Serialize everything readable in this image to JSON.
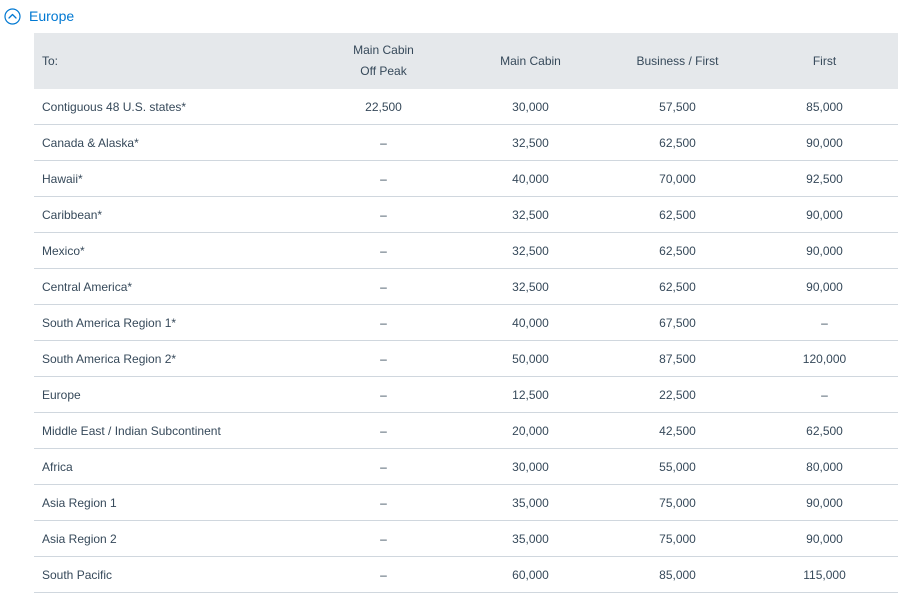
{
  "section": {
    "title": "Europe",
    "toggle_icon": "chevron-up-circle-icon",
    "accent_color": "#0078d2"
  },
  "table": {
    "headers": {
      "to": "To:",
      "main_off_peak_line1": "Main Cabin",
      "main_off_peak_line2": "Off Peak",
      "main_cabin": "Main Cabin",
      "business_first": "Business / First",
      "first": "First"
    },
    "rows": [
      {
        "region": "Contiguous 48 U.S. states*",
        "off_peak": "22,500",
        "main": "30,000",
        "business": "57,500",
        "first": "85,000"
      },
      {
        "region": "Canada & Alaska*",
        "off_peak": "–",
        "main": "32,500",
        "business": "62,500",
        "first": "90,000"
      },
      {
        "region": "Hawaii*",
        "off_peak": "–",
        "main": "40,000",
        "business": "70,000",
        "first": "92,500"
      },
      {
        "region": "Caribbean*",
        "off_peak": "–",
        "main": "32,500",
        "business": "62,500",
        "first": "90,000"
      },
      {
        "region": "Mexico*",
        "off_peak": "–",
        "main": "32,500",
        "business": "62,500",
        "first": "90,000"
      },
      {
        "region": "Central America*",
        "off_peak": "–",
        "main": "32,500",
        "business": "62,500",
        "first": "90,000"
      },
      {
        "region": "South America Region 1*",
        "off_peak": "–",
        "main": "40,000",
        "business": "67,500",
        "first": "–"
      },
      {
        "region": "South America Region 2*",
        "off_peak": "–",
        "main": "50,000",
        "business": "87,500",
        "first": "120,000"
      },
      {
        "region": "Europe",
        "off_peak": "–",
        "main": "12,500",
        "business": "22,500",
        "first": "–"
      },
      {
        "region": "Middle East / Indian Subcontinent",
        "off_peak": "–",
        "main": "20,000",
        "business": "42,500",
        "first": "62,500"
      },
      {
        "region": "Africa",
        "off_peak": "–",
        "main": "30,000",
        "business": "55,000",
        "first": "80,000"
      },
      {
        "region": "Asia Region 1",
        "off_peak": "–",
        "main": "35,000",
        "business": "75,000",
        "first": "90,000"
      },
      {
        "region": "Asia Region 2",
        "off_peak": "–",
        "main": "35,000",
        "business": "75,000",
        "first": "90,000"
      },
      {
        "region": "South Pacific",
        "off_peak": "–",
        "main": "60,000",
        "business": "85,000",
        "first": "115,000"
      }
    ]
  }
}
